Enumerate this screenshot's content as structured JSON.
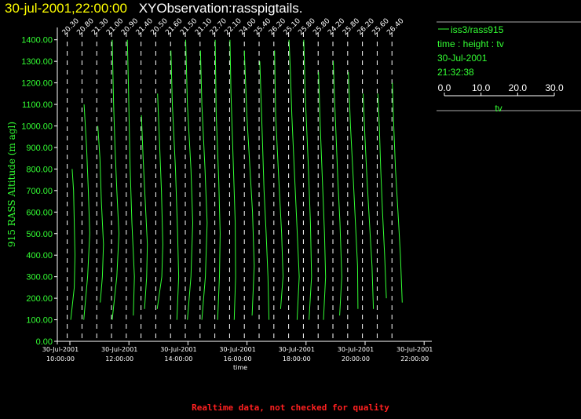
{
  "header": {
    "date_time": "30-jul-2001,22:00:00",
    "observation": "XYObservation:rasspigtails."
  },
  "legend": {
    "series_label": "iss3/rass915",
    "relation": "time : height : tv",
    "date": "30-Jul-2001",
    "time": "21:32:38",
    "scale_ticks": [
      "0.0",
      "10.0",
      "20.0",
      "30.0"
    ],
    "scale_min": 0,
    "scale_max": 30,
    "scale_label": "tv"
  },
  "footer": {
    "note": "Realtime data, not checked for quality"
  },
  "colors": {
    "trace": "#33ff33",
    "axis": "#ffffff",
    "title_date": "#ffff00",
    "footer": "#ff2020"
  },
  "chart_data": {
    "type": "line",
    "ylabel": "915 RASS Altitude (m agl)",
    "xlabel": "time",
    "ylim": [
      0,
      1450
    ],
    "y_ticks": [
      "0.00",
      "100.00",
      "200.00",
      "300.00",
      "400.00",
      "500.00",
      "600.00",
      "700.00",
      "800.00",
      "900.00",
      "1000.00",
      "1100.00",
      "1200.00",
      "1300.00",
      "1400.00"
    ],
    "xlim_hours": [
      9.8,
      22.15
    ],
    "x_ticks": [
      {
        "hour": 10,
        "date": "30-Jul-2001",
        "time": "10:00:00"
      },
      {
        "hour": 12,
        "date": "30-Jul-2001",
        "time": "12:00:00"
      },
      {
        "hour": 14,
        "date": "30-Jul-2001",
        "time": "14:00:00"
      },
      {
        "hour": 16,
        "date": "30-Jul-2001",
        "time": "16:00:00"
      },
      {
        "hour": 18,
        "date": "30-Jul-2001",
        "time": "18:00:00"
      },
      {
        "hour": 20,
        "date": "30-Jul-2001",
        "time": "20:00:00"
      },
      {
        "hour": 22,
        "date": "30-Jul-2001",
        "time": "22:00:00"
      }
    ],
    "profiles": [
      {
        "hour": 9.91,
        "label": "20.30",
        "points": [
          [
            1.0,
            100
          ],
          [
            2.0,
            250
          ],
          [
            2.2,
            400
          ],
          [
            2.0,
            550
          ],
          [
            1.8,
            700
          ],
          [
            1.4,
            800
          ]
        ]
      },
      {
        "hour": 10.41,
        "label": "20.80",
        "points": [
          [
            0.5,
            100
          ],
          [
            1.6,
            300
          ],
          [
            2.2,
            500
          ],
          [
            1.8,
            700
          ],
          [
            1.3,
            900
          ],
          [
            0.6,
            1100
          ]
        ]
      },
      {
        "hour": 10.91,
        "label": "21.30",
        "points": [
          [
            1.0,
            180
          ],
          [
            1.6,
            300
          ],
          [
            1.9,
            450
          ],
          [
            1.3,
            650
          ],
          [
            0.9,
            850
          ],
          [
            0.3,
            1000
          ]
        ]
      },
      {
        "hour": 11.41,
        "label": "21.00",
        "points": [
          [
            0.2,
            100
          ],
          [
            1.5,
            300
          ],
          [
            2.1,
            500
          ],
          [
            1.5,
            700
          ],
          [
            1.0,
            900
          ],
          [
            0.6,
            1100
          ],
          [
            0.2,
            1400
          ]
        ]
      },
      {
        "hour": 11.91,
        "label": "20.90",
        "points": [
          [
            2.0,
            120
          ],
          [
            2.3,
            300
          ],
          [
            1.6,
            550
          ],
          [
            1.1,
            800
          ],
          [
            0.9,
            950
          ],
          [
            0.6,
            1200
          ],
          [
            0.3,
            1400
          ]
        ]
      },
      {
        "hour": 12.41,
        "label": "21.40",
        "points": [
          [
            1.0,
            150
          ],
          [
            1.6,
            300
          ],
          [
            1.8,
            450
          ],
          [
            1.2,
            650
          ],
          [
            0.6,
            850
          ],
          [
            0.1,
            1050
          ]
        ]
      },
      {
        "hour": 12.91,
        "label": "20.50",
        "points": [
          [
            0.4,
            150
          ],
          [
            1.7,
            300
          ],
          [
            2.0,
            450
          ],
          [
            1.6,
            700
          ],
          [
            1.0,
            950
          ],
          [
            0.5,
            1150
          ]
        ]
      },
      {
        "hour": 13.41,
        "label": "21.60",
        "points": [
          [
            1.8,
            100
          ],
          [
            2.3,
            300
          ],
          [
            2.0,
            500
          ],
          [
            1.4,
            800
          ],
          [
            0.5,
            1100
          ],
          [
            0.1,
            1350
          ]
        ]
      },
      {
        "hour": 13.91,
        "label": "21.50",
        "points": [
          [
            0.6,
            100
          ],
          [
            1.6,
            300
          ],
          [
            2.1,
            550
          ],
          [
            1.6,
            800
          ],
          [
            0.6,
            1100
          ],
          [
            0.1,
            1400
          ]
        ]
      },
      {
        "hour": 14.41,
        "label": "21.10",
        "points": [
          [
            0.5,
            100
          ],
          [
            1.5,
            300
          ],
          [
            2.0,
            550
          ],
          [
            1.4,
            800
          ],
          [
            0.5,
            1100
          ],
          [
            0.1,
            1350
          ]
        ]
      },
      {
        "hour": 14.91,
        "label": "22.70",
        "points": [
          [
            0.8,
            100
          ],
          [
            1.3,
            300
          ],
          [
            1.5,
            500
          ],
          [
            1.1,
            750
          ],
          [
            0.4,
            1050
          ],
          [
            0.1,
            1400
          ]
        ]
      },
      {
        "hour": 15.41,
        "label": "22.10",
        "points": [
          [
            1.3,
            100
          ],
          [
            1.7,
            300
          ],
          [
            1.6,
            550
          ],
          [
            1.0,
            850
          ],
          [
            0.4,
            1150
          ],
          [
            0.1,
            1400
          ]
        ]
      },
      {
        "hour": 15.91,
        "label": "24.00",
        "points": [
          [
            2.2,
            120
          ],
          [
            2.8,
            350
          ],
          [
            2.3,
            600
          ],
          [
            1.6,
            800
          ],
          [
            0.7,
            1050
          ],
          [
            0.0,
            1350
          ]
        ]
      },
      {
        "hour": 16.41,
        "label": "25.40",
        "points": [
          [
            2.8,
            100
          ],
          [
            2.5,
            300
          ],
          [
            2.0,
            500
          ],
          [
            1.4,
            700
          ],
          [
            0.9,
            950
          ],
          [
            0.5,
            1150
          ],
          [
            0.2,
            1300
          ]
        ]
      },
      {
        "hour": 16.91,
        "label": "26.20",
        "points": [
          [
            1.9,
            150
          ],
          [
            2.6,
            300
          ],
          [
            2.2,
            500
          ],
          [
            1.4,
            750
          ],
          [
            0.5,
            1050
          ],
          [
            0.2,
            1350
          ]
        ]
      },
      {
        "hour": 17.41,
        "label": "25.10",
        "points": [
          [
            2.4,
            100
          ],
          [
            3.0,
            300
          ],
          [
            2.3,
            550
          ],
          [
            1.6,
            800
          ],
          [
            0.9,
            1050
          ],
          [
            0.5,
            1250
          ],
          [
            0.1,
            1400
          ]
        ]
      },
      {
        "hour": 17.91,
        "label": "25.80",
        "points": [
          [
            1.6,
            100
          ],
          [
            2.3,
            300
          ],
          [
            2.0,
            550
          ],
          [
            1.3,
            850
          ],
          [
            0.5,
            1150
          ],
          [
            0.1,
            1400
          ]
        ]
      },
      {
        "hour": 18.41,
        "label": "25.80",
        "points": [
          [
            1.5,
            100
          ],
          [
            2.1,
            300
          ],
          [
            1.8,
            500
          ],
          [
            1.2,
            750
          ],
          [
            0.6,
            1000
          ],
          [
            0.1,
            1250
          ]
        ]
      },
      {
        "hour": 18.91,
        "label": "24.20",
        "points": [
          [
            1.9,
            120
          ],
          [
            2.5,
            300
          ],
          [
            2.0,
            550
          ],
          [
            1.4,
            750
          ],
          [
            0.9,
            950
          ],
          [
            0.4,
            1150
          ],
          [
            0.1,
            1300
          ]
        ]
      },
      {
        "hour": 19.41,
        "label": "25.80",
        "points": [
          [
            2.9,
            150
          ],
          [
            2.8,
            350
          ],
          [
            2.2,
            550
          ],
          [
            1.6,
            750
          ],
          [
            0.8,
            1000
          ],
          [
            0.2,
            1250
          ]
        ]
      },
      {
        "hour": 19.91,
        "label": "26.20",
        "points": [
          [
            3.1,
            150
          ],
          [
            2.7,
            350
          ],
          [
            2.0,
            550
          ],
          [
            1.3,
            750
          ],
          [
            0.7,
            950
          ],
          [
            0.2,
            1150
          ]
        ]
      },
      {
        "hour": 20.41,
        "label": "25.60",
        "points": [
          [
            2.6,
            200
          ],
          [
            2.1,
            400
          ],
          [
            1.5,
            600
          ],
          [
            1.0,
            800
          ],
          [
            0.6,
            1000
          ],
          [
            0.2,
            1150
          ]
        ]
      },
      {
        "hour": 20.91,
        "label": "26.40",
        "points": [
          [
            2.9,
            180
          ],
          [
            2.4,
            400
          ],
          [
            1.7,
            600
          ],
          [
            1.0,
            800
          ],
          [
            0.5,
            1000
          ],
          [
            0.1,
            1200
          ]
        ]
      }
    ]
  }
}
